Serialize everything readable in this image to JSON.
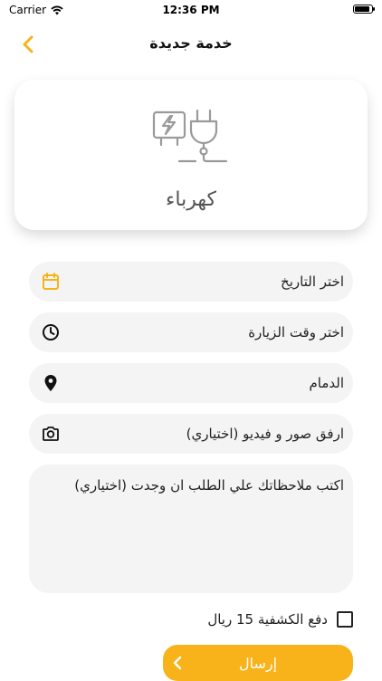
{
  "status_bar": {
    "carrier": "Carrier",
    "time": "12:36 PM"
  },
  "header": {
    "title": "خدمة جديدة"
  },
  "service": {
    "name": "كهرباء",
    "icon": "electric-plug-icon"
  },
  "fields": {
    "date": {
      "label": "اختر التاريخ",
      "icon": "calendar-icon"
    },
    "time": {
      "label": "اختر وقت الزيارة",
      "icon": "clock-icon"
    },
    "location": {
      "label": "الدمام",
      "icon": "location-pin-icon"
    },
    "attachments": {
      "label": "ارفق صور و فيديو (اختياري)",
      "icon": "camera-icon"
    }
  },
  "notes": {
    "placeholder": "اكتب ملاحظاتك علي الطلب ان وجدت (اختياري)",
    "value": ""
  },
  "inspection_fee": {
    "label": "دفع الكشفية 15 ريال",
    "checked": false
  },
  "submit": {
    "label": "إرسال"
  },
  "colors": {
    "accent": "#f8b31a",
    "field_bg": "#f4f4f4",
    "icon_gray": "#9a9a9a"
  }
}
